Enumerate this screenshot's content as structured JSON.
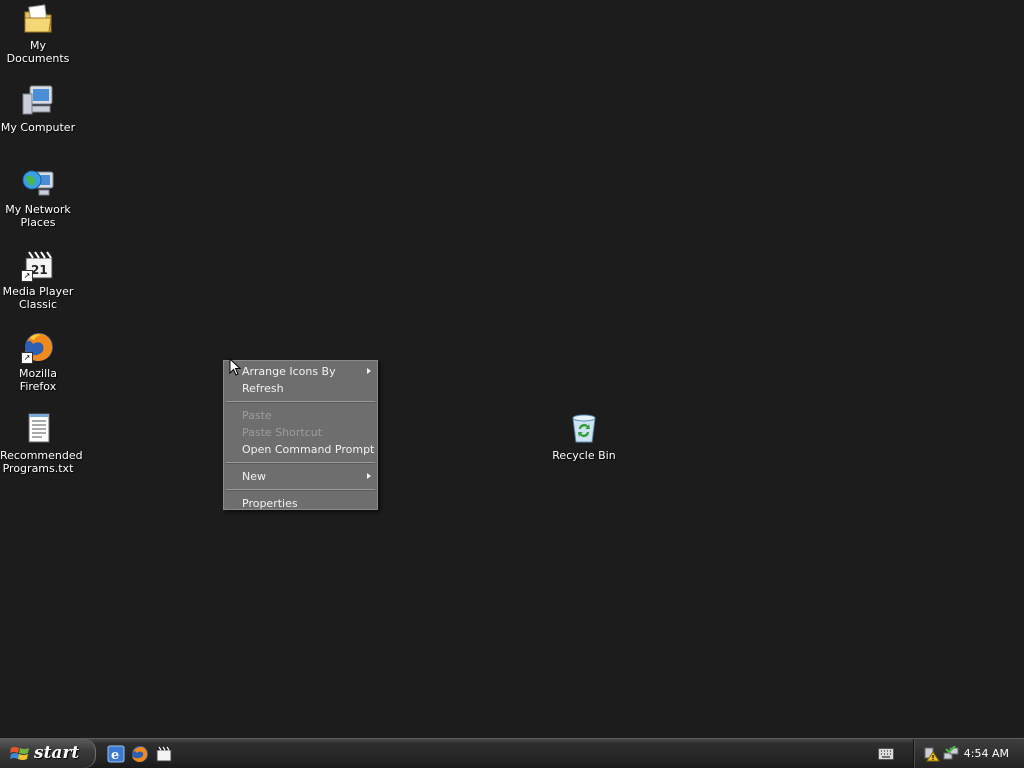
{
  "desktop_icons": [
    {
      "label": "My Documents",
      "icon": "my-documents-icon"
    },
    {
      "label": "My Computer",
      "icon": "my-computer-icon"
    },
    {
      "label": "My Network Places",
      "icon": "network-places-icon"
    },
    {
      "label": "Media Player Classic",
      "icon": "media-player-classic-icon"
    },
    {
      "label": "Mozilla Firefox",
      "icon": "firefox-icon"
    },
    {
      "label": "Recommended Programs.txt",
      "icon": "text-file-icon"
    },
    {
      "label": "Recycle Bin",
      "icon": "recycle-bin-icon"
    }
  ],
  "context_menu": {
    "items": [
      {
        "label": "Arrange Icons By",
        "submenu": true,
        "enabled": true
      },
      {
        "label": "Refresh",
        "submenu": false,
        "enabled": true
      },
      {
        "label": "Paste",
        "submenu": false,
        "enabled": false
      },
      {
        "label": "Paste Shortcut",
        "submenu": false,
        "enabled": false
      },
      {
        "label": "Open Command Prompt",
        "submenu": false,
        "enabled": true
      },
      {
        "label": "New",
        "submenu": true,
        "enabled": true
      },
      {
        "label": "Properties",
        "submenu": false,
        "enabled": true
      }
    ]
  },
  "taskbar": {
    "start_label": "start",
    "quick_launch": [
      "internet-explorer-icon",
      "firefox-icon",
      "media-player-classic-icon"
    ],
    "tray_icons": [
      "keyboard-icon",
      "security-warning-icon",
      "network-icon"
    ],
    "clock": "4:54 AM"
  },
  "colors": {
    "desktop_background": "#1c1c1c",
    "menu_background": "#6e6e6e",
    "menu_text": "#f2f2f2",
    "menu_disabled_text": "#9c9c9c"
  }
}
